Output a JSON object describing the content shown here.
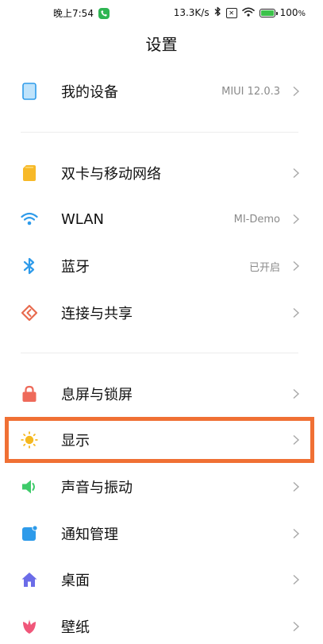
{
  "status_bar": {
    "time": "晚上7:54",
    "speed": "13.3K/s",
    "battery": "100",
    "battery_unit": "%",
    "icons": [
      "wechat-icon",
      "bluetooth-icon",
      "sim-off-icon",
      "wifi-icon",
      "battery-icon"
    ]
  },
  "header": {
    "title": "设置"
  },
  "items": {
    "my_device": {
      "label": "我的设备",
      "value": "MIUI 12.0.3",
      "icon": "phone-icon",
      "color": "#2e9bea"
    },
    "sim": {
      "label": "双卡与移动网络",
      "icon": "sim-card-icon",
      "color": "#f7b928"
    },
    "wlan": {
      "label": "WLAN",
      "value": "MI-Demo",
      "icon": "wifi-icon",
      "color": "#2e9bea"
    },
    "bluetooth": {
      "label": "蓝牙",
      "value": "已开启",
      "icon": "bluetooth-icon",
      "color": "#2e9bea"
    },
    "share": {
      "label": "连接与共享",
      "icon": "connection-share-icon",
      "color": "#e86b4f"
    },
    "lock": {
      "label": "息屏与锁屏",
      "icon": "lock-icon",
      "color": "#ee6a5a"
    },
    "display": {
      "label": "显示",
      "icon": "sun-icon",
      "color": "#f5b820"
    },
    "sound": {
      "label": "声音与振动",
      "icon": "speaker-icon",
      "color": "#3ecb6a"
    },
    "notifications": {
      "label": "通知管理",
      "icon": "notification-icon",
      "color": "#2e9bea"
    },
    "home": {
      "label": "桌面",
      "icon": "home-icon",
      "color": "#6b6ce8"
    },
    "wallpaper": {
      "label": "壁纸",
      "icon": "tulip-icon",
      "color": "#f0577a"
    }
  },
  "highlight": {
    "target": "display",
    "color": "#f07034"
  }
}
